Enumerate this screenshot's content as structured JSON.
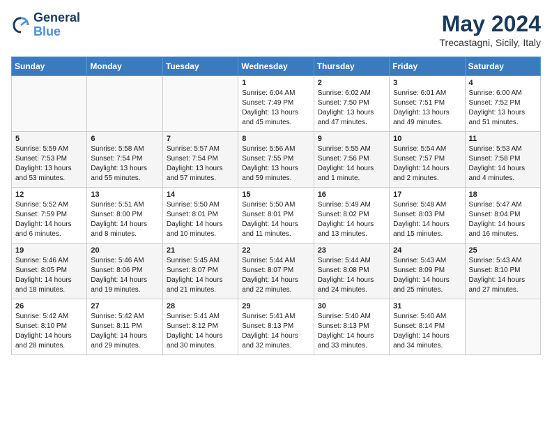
{
  "header": {
    "logo_line1": "General",
    "logo_line2": "Blue",
    "month_year": "May 2024",
    "location": "Trecastagni, Sicily, Italy"
  },
  "weekdays": [
    "Sunday",
    "Monday",
    "Tuesday",
    "Wednesday",
    "Thursday",
    "Friday",
    "Saturday"
  ],
  "weeks": [
    [
      {
        "day": "",
        "content": ""
      },
      {
        "day": "",
        "content": ""
      },
      {
        "day": "",
        "content": ""
      },
      {
        "day": "1",
        "content": "Sunrise: 6:04 AM\nSunset: 7:49 PM\nDaylight: 13 hours\nand 45 minutes."
      },
      {
        "day": "2",
        "content": "Sunrise: 6:02 AM\nSunset: 7:50 PM\nDaylight: 13 hours\nand 47 minutes."
      },
      {
        "day": "3",
        "content": "Sunrise: 6:01 AM\nSunset: 7:51 PM\nDaylight: 13 hours\nand 49 minutes."
      },
      {
        "day": "4",
        "content": "Sunrise: 6:00 AM\nSunset: 7:52 PM\nDaylight: 13 hours\nand 51 minutes."
      }
    ],
    [
      {
        "day": "5",
        "content": "Sunrise: 5:59 AM\nSunset: 7:53 PM\nDaylight: 13 hours\nand 53 minutes."
      },
      {
        "day": "6",
        "content": "Sunrise: 5:58 AM\nSunset: 7:54 PM\nDaylight: 13 hours\nand 55 minutes."
      },
      {
        "day": "7",
        "content": "Sunrise: 5:57 AM\nSunset: 7:54 PM\nDaylight: 13 hours\nand 57 minutes."
      },
      {
        "day": "8",
        "content": "Sunrise: 5:56 AM\nSunset: 7:55 PM\nDaylight: 13 hours\nand 59 minutes."
      },
      {
        "day": "9",
        "content": "Sunrise: 5:55 AM\nSunset: 7:56 PM\nDaylight: 14 hours\nand 1 minute."
      },
      {
        "day": "10",
        "content": "Sunrise: 5:54 AM\nSunset: 7:57 PM\nDaylight: 14 hours\nand 2 minutes."
      },
      {
        "day": "11",
        "content": "Sunrise: 5:53 AM\nSunset: 7:58 PM\nDaylight: 14 hours\nand 4 minutes."
      }
    ],
    [
      {
        "day": "12",
        "content": "Sunrise: 5:52 AM\nSunset: 7:59 PM\nDaylight: 14 hours\nand 6 minutes."
      },
      {
        "day": "13",
        "content": "Sunrise: 5:51 AM\nSunset: 8:00 PM\nDaylight: 14 hours\nand 8 minutes."
      },
      {
        "day": "14",
        "content": "Sunrise: 5:50 AM\nSunset: 8:01 PM\nDaylight: 14 hours\nand 10 minutes."
      },
      {
        "day": "15",
        "content": "Sunrise: 5:50 AM\nSunset: 8:01 PM\nDaylight: 14 hours\nand 11 minutes."
      },
      {
        "day": "16",
        "content": "Sunrise: 5:49 AM\nSunset: 8:02 PM\nDaylight: 14 hours\nand 13 minutes."
      },
      {
        "day": "17",
        "content": "Sunrise: 5:48 AM\nSunset: 8:03 PM\nDaylight: 14 hours\nand 15 minutes."
      },
      {
        "day": "18",
        "content": "Sunrise: 5:47 AM\nSunset: 8:04 PM\nDaylight: 14 hours\nand 16 minutes."
      }
    ],
    [
      {
        "day": "19",
        "content": "Sunrise: 5:46 AM\nSunset: 8:05 PM\nDaylight: 14 hours\nand 18 minutes."
      },
      {
        "day": "20",
        "content": "Sunrise: 5:46 AM\nSunset: 8:06 PM\nDaylight: 14 hours\nand 19 minutes."
      },
      {
        "day": "21",
        "content": "Sunrise: 5:45 AM\nSunset: 8:07 PM\nDaylight: 14 hours\nand 21 minutes."
      },
      {
        "day": "22",
        "content": "Sunrise: 5:44 AM\nSunset: 8:07 PM\nDaylight: 14 hours\nand 22 minutes."
      },
      {
        "day": "23",
        "content": "Sunrise: 5:44 AM\nSunset: 8:08 PM\nDaylight: 14 hours\nand 24 minutes."
      },
      {
        "day": "24",
        "content": "Sunrise: 5:43 AM\nSunset: 8:09 PM\nDaylight: 14 hours\nand 25 minutes."
      },
      {
        "day": "25",
        "content": "Sunrise: 5:43 AM\nSunset: 8:10 PM\nDaylight: 14 hours\nand 27 minutes."
      }
    ],
    [
      {
        "day": "26",
        "content": "Sunrise: 5:42 AM\nSunset: 8:10 PM\nDaylight: 14 hours\nand 28 minutes."
      },
      {
        "day": "27",
        "content": "Sunrise: 5:42 AM\nSunset: 8:11 PM\nDaylight: 14 hours\nand 29 minutes."
      },
      {
        "day": "28",
        "content": "Sunrise: 5:41 AM\nSunset: 8:12 PM\nDaylight: 14 hours\nand 30 minutes."
      },
      {
        "day": "29",
        "content": "Sunrise: 5:41 AM\nSunset: 8:13 PM\nDaylight: 14 hours\nand 32 minutes."
      },
      {
        "day": "30",
        "content": "Sunrise: 5:40 AM\nSunset: 8:13 PM\nDaylight: 14 hours\nand 33 minutes."
      },
      {
        "day": "31",
        "content": "Sunrise: 5:40 AM\nSunset: 8:14 PM\nDaylight: 14 hours\nand 34 minutes."
      },
      {
        "day": "",
        "content": ""
      }
    ]
  ]
}
